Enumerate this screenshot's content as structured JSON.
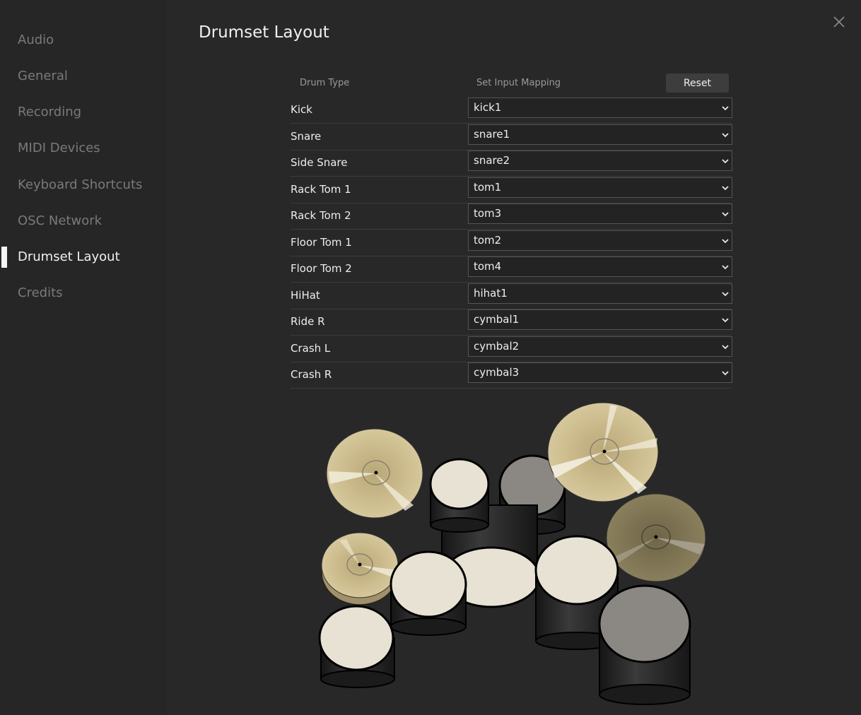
{
  "sidebar": {
    "items": [
      {
        "label": "Audio"
      },
      {
        "label": "General"
      },
      {
        "label": "Recording"
      },
      {
        "label": "MIDI Devices"
      },
      {
        "label": "Keyboard Shortcuts"
      },
      {
        "label": "OSC Network"
      },
      {
        "label": "Drumset Layout",
        "active": true
      },
      {
        "label": "Credits"
      }
    ]
  },
  "header": {
    "title": "Drumset Layout",
    "close_icon": "close-icon"
  },
  "table": {
    "col_drum_type": "Drum Type",
    "col_mapping": "Set Input Mapping",
    "reset_label": "Reset",
    "rows": [
      {
        "drum": "Kick",
        "mapping": "kick1"
      },
      {
        "drum": "Snare",
        "mapping": "snare1"
      },
      {
        "drum": "Side Snare",
        "mapping": "snare2"
      },
      {
        "drum": "Rack Tom 1",
        "mapping": "tom1"
      },
      {
        "drum": "Rack Tom 2",
        "mapping": "tom3"
      },
      {
        "drum": "Floor Tom 1",
        "mapping": "tom2"
      },
      {
        "drum": "Floor Tom 2",
        "mapping": "tom4"
      },
      {
        "drum": "HiHat",
        "mapping": "hihat1"
      },
      {
        "drum": "Ride R",
        "mapping": "cymbal1"
      },
      {
        "drum": "Crash L",
        "mapping": "cymbal2"
      },
      {
        "drum": "Crash R",
        "mapping": "cymbal3"
      }
    ]
  },
  "colors": {
    "background": "#262626",
    "active_text": "#f0f0f0",
    "inactive_text": "#7a7a7a",
    "cymbal": "#c9b98a",
    "drum_head": "#e8e2d4"
  }
}
